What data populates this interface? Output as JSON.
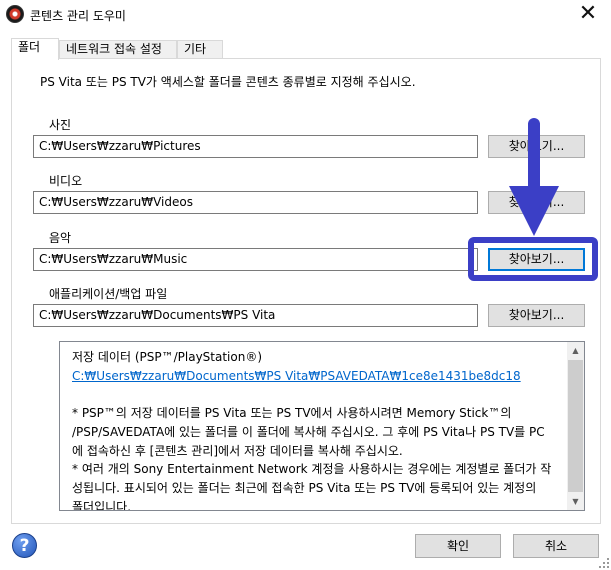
{
  "window": {
    "title": "콘텐츠 관리 도우미",
    "close_glyph": "✕"
  },
  "tabs": [
    {
      "label": "폴더",
      "active": true
    },
    {
      "label": "네트워크 접속 설정",
      "active": false
    },
    {
      "label": "기타",
      "active": false
    }
  ],
  "folder_tab": {
    "instruction": "PS Vita 또는 PS TV가 액세스할 폴더를 콘텐츠 종류별로 지정해 주십시오.",
    "browse_label": "찾아보기...",
    "folders": [
      {
        "label": "사진",
        "path": "C:₩Users₩zzaru₩Pictures"
      },
      {
        "label": "비디오",
        "path": "C:₩Users₩zzaru₩Videos"
      },
      {
        "label": "음악",
        "path": "C:₩Users₩zzaru₩Music"
      },
      {
        "label": "애플리케이션/백업 파일",
        "path": "C:₩Users₩zzaru₩Documents₩PS Vita"
      }
    ],
    "info": {
      "heading": "저장 데이터 (PSP™/PlayStation®)",
      "link": "C:₩Users₩zzaru₩Documents₩PS Vita₩PSAVEDATA₩1ce8e1431be8dc18",
      "para1_line1": "* PSP™의 저장 데이터를 PS Vita 또는 PS TV에서 사용하시려면 Memory Stick™의",
      "para1_line2": "/PSP/SAVEDATA에 있는 폴더를 이 폴더에 복사해 주십시오. 그 후에 PS Vita나 PS TV를 PC",
      "para1_line3": "에 접속하신 후 [콘텐츠 관리]에서 저장 데이터를 복사해 주십시오.",
      "para2_line1": "* 여러 개의 Sony Entertainment Network 계정을 사용하시는 경우에는 계정별로 폴더가 작",
      "para2_line2": "성됩니다. 표시되어 있는 폴더는 최근에 접속한 PS Vita 또는 PS TV에 등록되어 있는 계정의",
      "para2_line3": "폴더입니다."
    }
  },
  "footer": {
    "ok_label": "확인",
    "cancel_label": "취소",
    "help_glyph": "?"
  },
  "colors": {
    "annotation": "#3b3fc6",
    "link": "#0066cc"
  },
  "icons": [
    "app-icon",
    "close-icon",
    "help-icon",
    "arrow-down-icon",
    "scroll-up-icon",
    "scroll-down-icon"
  ]
}
